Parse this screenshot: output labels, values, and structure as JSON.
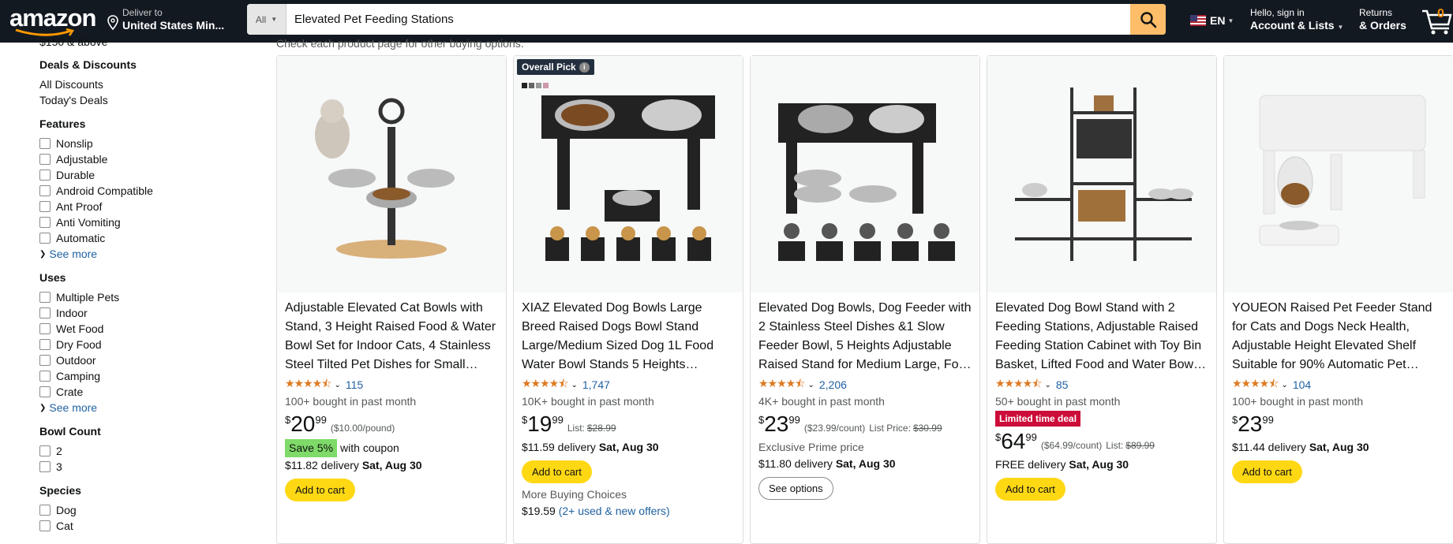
{
  "nav": {
    "logo": "amazon",
    "deliver_line1": "Deliver to",
    "deliver_line2": "United States Min...",
    "search_category": "All",
    "search_value": "Elevated Pet Feeding Stations",
    "lang": "EN",
    "account_line1": "Hello, sign in",
    "account_line2": "Account & Lists",
    "orders_line1": "Returns",
    "orders_line2": "& Orders",
    "cart_count": "0"
  },
  "sidebar": {
    "top_text": "$150 & above",
    "deals_heading": "Deals & Discounts",
    "deals": [
      "All Discounts",
      "Today's Deals"
    ],
    "features_heading": "Features",
    "features": [
      "Nonslip",
      "Adjustable",
      "Durable",
      "Android Compatible",
      "Ant Proof",
      "Anti Vomiting",
      "Automatic"
    ],
    "see_more": "See more",
    "uses_heading": "Uses",
    "uses": [
      "Multiple Pets",
      "Indoor",
      "Wet Food",
      "Dry Food",
      "Outdoor",
      "Camping",
      "Crate"
    ],
    "bowl_heading": "Bowl Count",
    "bowl": [
      "2",
      "3"
    ],
    "species_heading": "Species",
    "species": [
      "Dog",
      "Cat"
    ]
  },
  "main": {
    "note": "Check each product page for other buying options."
  },
  "products": [
    {
      "title": "Adjustable Elevated Cat Bowls with Stand, 3 Height Raised Food & Water Bowl Set for Indoor Cats, 4 Stainless Steel Tilted Pet Dishes for Small…",
      "rating": 4.5,
      "count": "115",
      "bought": "100+ bought in past month",
      "whole": "20",
      "frac": "99",
      "unit": "($10.00/pound)",
      "save": "Save 5%",
      "save_suffix": "with coupon",
      "delivery_prefix": "$11.82 delivery",
      "delivery_date": "Sat, Aug 30",
      "button": "Add to cart"
    },
    {
      "badge": "Overall Pick",
      "title": "XIAZ Elevated Dog Bowls Large Breed Raised Dogs Bowl Stand Large/Medium Sized Dog 1L Food Water Bowl Stands 5 Heights…",
      "rating": 4.5,
      "count": "1,747",
      "bought": "10K+ bought in past month",
      "whole": "19",
      "frac": "99",
      "list_label": "List:",
      "list_price": "$28.99",
      "delivery_prefix": "$11.59 delivery",
      "delivery_date": "Sat, Aug 30",
      "button": "Add to cart",
      "more_choices": "More Buying Choices",
      "more_price": "$19.59",
      "more_offers": "(2+ used & new offers)"
    },
    {
      "title": "Elevated Dog Bowls, Dog Feeder with 2 Stainless Steel Dishes &1 Slow Feeder Bowl, 5 Heights Adjustable Raised Stand for Medium Large, Fo…",
      "rating": 4.5,
      "count": "2,206",
      "bought": "4K+ bought in past month",
      "whole": "23",
      "frac": "99",
      "unit": "($23.99/count)",
      "list_label": "List Price:",
      "list_price": "$30.99",
      "prime_text": "Exclusive Prime price",
      "delivery_prefix": "$11.80 delivery",
      "delivery_date": "Sat, Aug 30",
      "button": "See options"
    },
    {
      "title": "Elevated Dog Bowl Stand with 2 Feeding Stations, Adjustable Raised Feeding Station Cabinet with Toy Bin Basket, Lifted Food and Water Bow…",
      "rating": 4.5,
      "count": "85",
      "bought": "50+ bought in past month",
      "deal": "Limited time deal",
      "whole": "64",
      "frac": "99",
      "unit": "($64.99/count)",
      "list_label": "List:",
      "list_price": "$89.99",
      "delivery_prefix": "FREE delivery",
      "delivery_date": "Sat, Aug 30",
      "button": "Add to cart"
    },
    {
      "title": "YOUEON Raised Pet Feeder Stand for Cats and Dogs Neck Health, Adjustable Height Elevated Shelf Suitable for 90% Automatic Pet…",
      "rating": 4.5,
      "count": "104",
      "bought": "100+ bought in past month",
      "whole": "23",
      "frac": "99",
      "delivery_prefix": "$11.44 delivery",
      "delivery_date": "Sat, Aug 30",
      "button": "Add to cart"
    }
  ],
  "colors": {
    "nav_bg": "#131921",
    "search_btn": "#febd69",
    "add_to_cart": "#ffd814",
    "link": "#2162a1",
    "stars": "#de7921",
    "deal_badge": "#cc0c39",
    "save_badge": "#7fda69"
  }
}
